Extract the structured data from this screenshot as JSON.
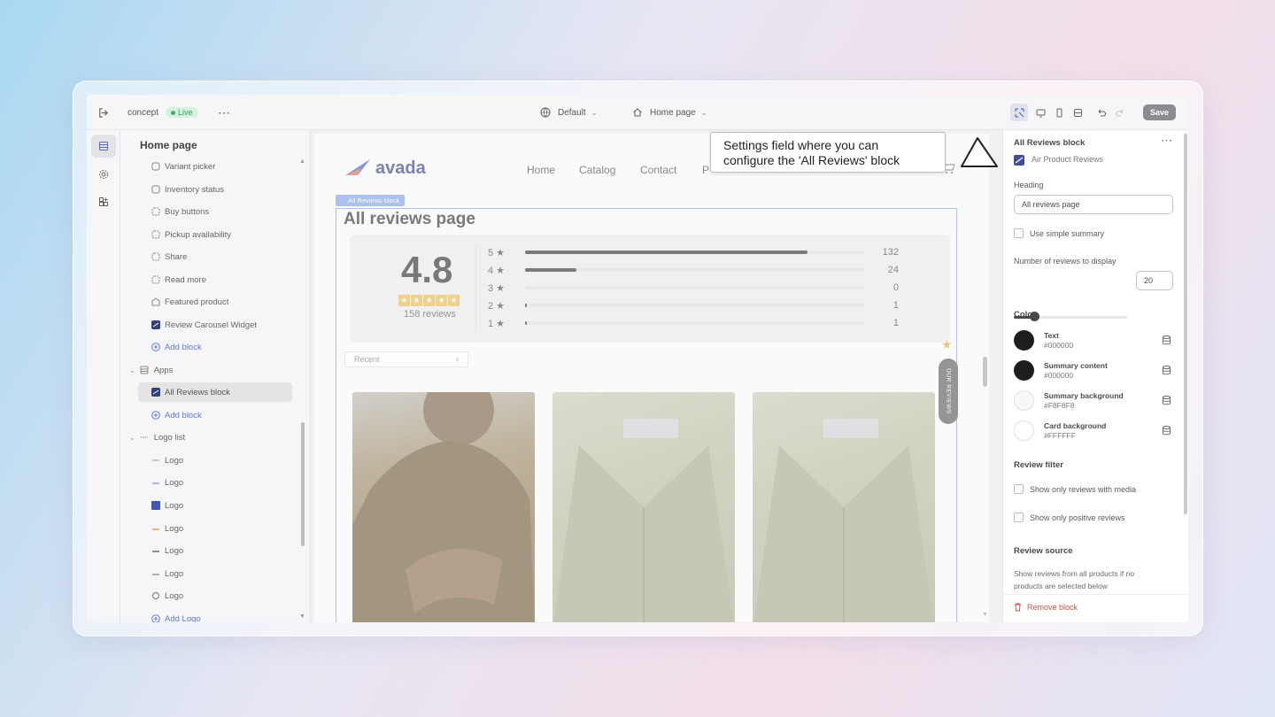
{
  "topbar": {
    "store_name": "concept",
    "status": "Live",
    "theme": "Default",
    "page": "Home page",
    "save_label": "Save"
  },
  "sidebar": {
    "title": "Home page",
    "items": [
      {
        "label": "Variant picker"
      },
      {
        "label": "Inventory status"
      },
      {
        "label": "Buy buttons"
      },
      {
        "label": "Pickup availability"
      },
      {
        "label": "Share"
      },
      {
        "label": "Read more"
      },
      {
        "label": "Featured product"
      },
      {
        "label": "Review Carousel Widget"
      },
      {
        "label": "Add block"
      },
      {
        "label": "Apps"
      },
      {
        "label": "All Reviews block"
      },
      {
        "label": "Add block"
      },
      {
        "label": "Logo list"
      },
      {
        "label": "Logo"
      },
      {
        "label": "Logo"
      },
      {
        "label": "Logo"
      },
      {
        "label": "Logo"
      },
      {
        "label": "Logo"
      },
      {
        "label": "Logo"
      },
      {
        "label": "Logo"
      },
      {
        "label": "Add Logo"
      }
    ]
  },
  "preview": {
    "logo_text": "avada",
    "nav": [
      "Home",
      "Catalog",
      "Contact",
      "P"
    ],
    "block_tag": "All Reviews block",
    "title": "All reviews page",
    "score": "4.8",
    "reviews_count": "158 reviews",
    "rating_rows": [
      {
        "label": "5 ★",
        "count": "132",
        "fraction": 0.83
      },
      {
        "label": "4 ★",
        "count": "24",
        "fraction": 0.15
      },
      {
        "label": "3 ★",
        "count": "0",
        "fraction": 0
      },
      {
        "label": "2 ★",
        "count": "1",
        "fraction": 0.006
      },
      {
        "label": "1 ★",
        "count": "1",
        "fraction": 0.006
      }
    ],
    "sort": "Recent",
    "side_tab": "OUR REVIEWS"
  },
  "callout": {
    "line1": "Settings field where you can",
    "line2": "configure the 'All Reviews' block"
  },
  "panel": {
    "title": "All Reviews block",
    "app_name": "Air Product Reviews",
    "heading_label": "Heading",
    "heading_value": "All reviews page",
    "simple_summary": "Use simple summary",
    "num_label": "Number of reviews to display",
    "num_value": "20",
    "slider_fraction": 0.18,
    "color_label": "Color",
    "colors": [
      {
        "name": "Text",
        "hex": "#000000"
      },
      {
        "name": "Summary content",
        "hex": "#000000"
      },
      {
        "name": "Summary background",
        "hex": "#F8F8F8"
      },
      {
        "name": "Card background",
        "hex": "#FFFFFF"
      }
    ],
    "filter_label": "Review filter",
    "filter_media": "Show only reviews with media",
    "filter_positive": "Show only positive reviews",
    "source_label": "Review source",
    "source_desc1": "Show reviews from all products if no",
    "source_desc2": "products are selected below",
    "remove_label": "Remove block"
  }
}
